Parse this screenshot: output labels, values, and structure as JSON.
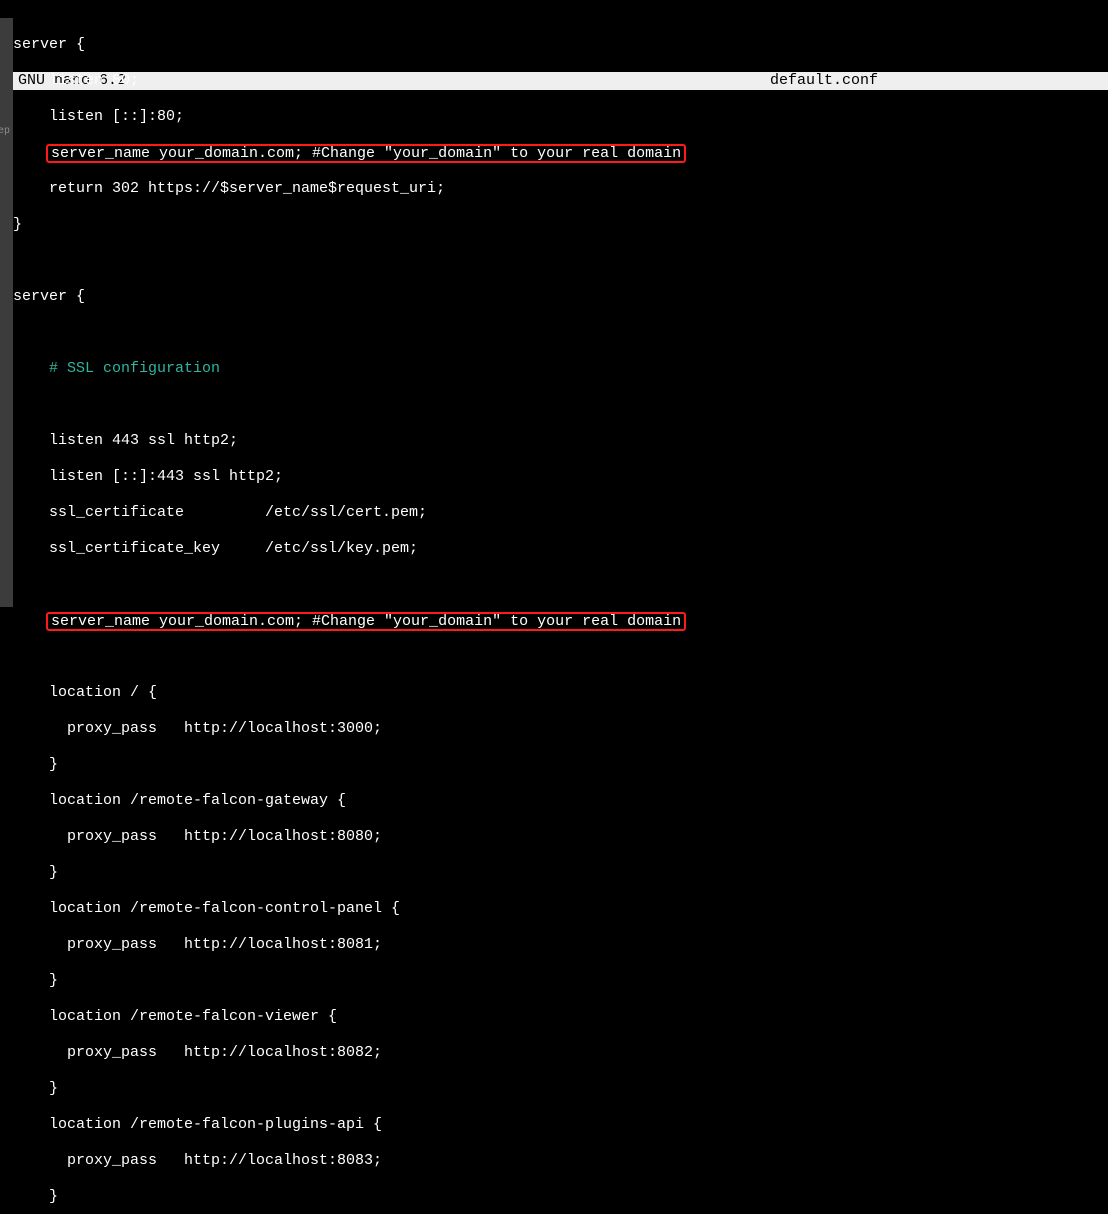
{
  "titlebar": {
    "app": "GNU nano 6.2",
    "filename": "default.conf"
  },
  "strip": {
    "label": "ep"
  },
  "code": {
    "l1": "server {",
    "l2": "listen 80;",
    "l3": "listen [::]:80;",
    "l4": "server_name your_domain.com; #Change \"your_domain\" to your real domain",
    "l5": "return 302 https://$server_name$request_uri;",
    "l6": "}",
    "l7": "",
    "l8": "server {",
    "l9": "",
    "l10": "# SSL configuration",
    "l11": "",
    "l12": "listen 443 ssl http2;",
    "l13": "listen [::]:443 ssl http2;",
    "l14": "ssl_certificate         /etc/ssl/cert.pem;",
    "l15": "ssl_certificate_key     /etc/ssl/key.pem;",
    "l16": "",
    "l17": "server_name your_domain.com; #Change \"your_domain\" to your real domain",
    "l18": "",
    "l19": "location / {",
    "l20": "proxy_pass   http://localhost:3000;",
    "l21": "}",
    "l22": "location /remote-falcon-gateway {",
    "l23": "proxy_pass   http://localhost:8080;",
    "l24": "}",
    "l25": "location /remote-falcon-control-panel {",
    "l26": "proxy_pass   http://localhost:8081;",
    "l27": "}",
    "l28": "location /remote-falcon-viewer {",
    "l29": "proxy_pass   http://localhost:8082;",
    "l30": "}",
    "l31": "location /remote-falcon-plugins-api {",
    "l32": "proxy_pass   http://localhost:8083;",
    "l33": "}"
  }
}
